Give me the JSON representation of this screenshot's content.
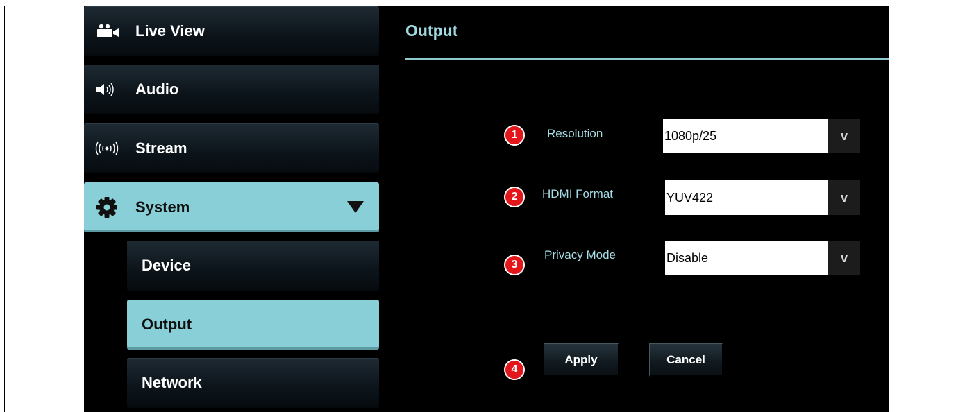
{
  "sidebar": {
    "items": [
      {
        "label": "Live View",
        "icon": "video-camera-icon"
      },
      {
        "label": "Audio",
        "icon": "speaker-icon"
      },
      {
        "label": "Stream",
        "icon": "broadcast-icon"
      },
      {
        "label": "System",
        "icon": "gear-icon",
        "expanded": true
      },
      {
        "label": "Device"
      },
      {
        "label": "Output",
        "active": true
      },
      {
        "label": "Network"
      }
    ]
  },
  "main": {
    "title": "Output",
    "fields": [
      {
        "badge": "1",
        "label": "Resolution",
        "value": "1080p/25"
      },
      {
        "badge": "2",
        "label": "HDMI Format",
        "value": "YUV422"
      },
      {
        "badge": "3",
        "label": "Privacy Mode",
        "value": "Disable"
      }
    ],
    "actions": {
      "badge": "4",
      "apply": "Apply",
      "cancel": "Cancel"
    },
    "arrow_glyph": "v"
  },
  "colors": {
    "accent": "#88cfd8",
    "title": "#9fd9e2",
    "badge": "#e3161b",
    "background": "#000000"
  }
}
